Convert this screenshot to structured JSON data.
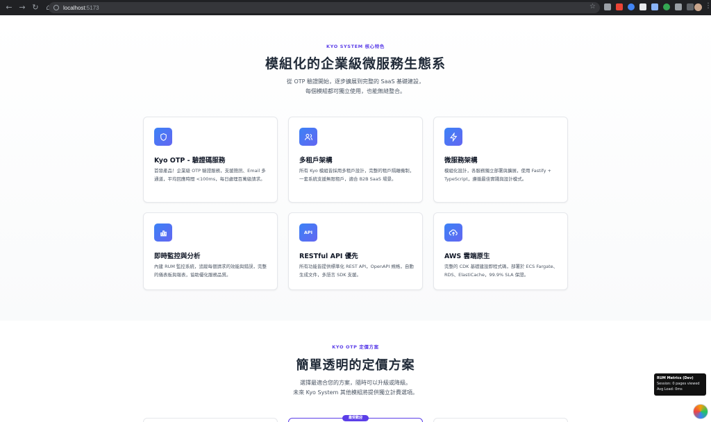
{
  "browser": {
    "url_host": "localhost",
    "url_port": ":5173"
  },
  "features_section": {
    "eyebrow": "KYO SYSTEM 核心特色",
    "title": "模組化的企業級微服務生態系",
    "lede_line1": "從 OTP 驗證開始，逐步擴展到完整的 SaaS 基礎建設，",
    "lede_line2": "每個模組都可獨立使用，也能無縫整合。",
    "cards": [
      {
        "icon": "shield-icon",
        "title": "Kyo OTP - 驗證碼服務",
        "desc": "首發產品！企業級 OTP 驗證服務，支援簡訊、Email 多通道，平均回應時間 <100ms，每日處理百萬級請求。"
      },
      {
        "icon": "users-icon",
        "title": "多租戶架構",
        "desc": "所有 Kyo 模組皆採用多租戶設計，完整的租戶隔離機制，一套系統支援無限租戶，適合 B2B SaaS 場景。"
      },
      {
        "icon": "lightning-icon",
        "title": "微服務架構",
        "desc": "模組化設計，各服務獨立部署與擴展，使用 Fastify + TypeScript，遵循最佳實踐與設計模式。"
      },
      {
        "icon": "bar-chart-icon",
        "title": "即時監控與分析",
        "desc": "內建 RUM 監控系統，追蹤每個請求的效能與錯誤，完整的儀表板與報表，協助優化服務品質。"
      },
      {
        "icon": "api-icon",
        "title": "RESTful API 優先",
        "desc": "所有功能皆提供標準化 REST API，OpenAPI 規格，自動生成文件，多語言 SDK 支援。"
      },
      {
        "icon": "cloud-upload-icon",
        "title": "AWS 雲端原生",
        "desc": "完整的 CDK 基礎建設即程式碼，部署於 ECS Fargate、RDS、ElastiCache，99.9% SLA 保證。"
      }
    ]
  },
  "pricing_section": {
    "eyebrow": "KYO OTP 定價方案",
    "title": "簡單透明的定價方案",
    "lede_line1": "選擇最適合您的方案，隨時可以升級或降級。",
    "lede_line2": "未來 Kyo System 其他模組將提供獨立計費選項。",
    "badge": "最受歡迎"
  },
  "rum_widget": {
    "title": "RUM Metrics (Dev)",
    "session": "Session: 0 pages viewed",
    "avg_load": "Avg Load: 0ms"
  },
  "colors": {
    "accent": "#5b3ee8",
    "icon_gradient_start": "#3b82f6",
    "icon_gradient_end": "#6366f1"
  }
}
